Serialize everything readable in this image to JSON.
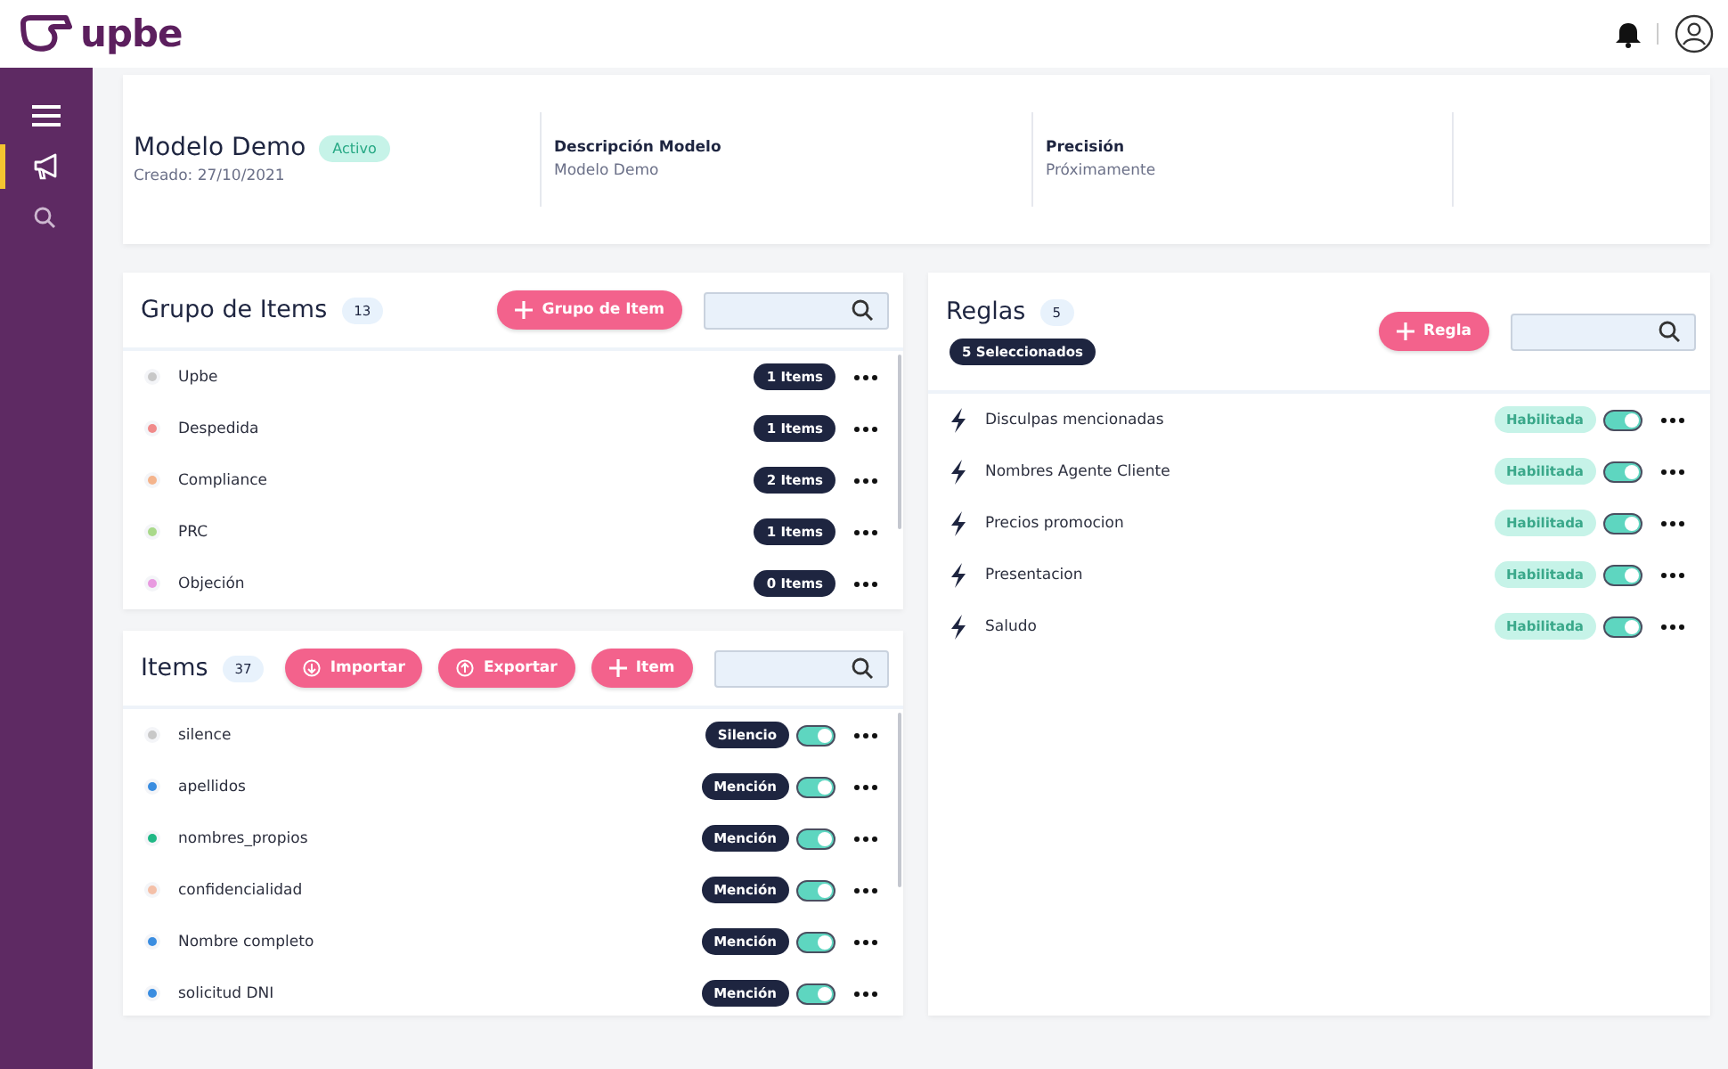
{
  "header": {
    "brand": "upbe"
  },
  "sidebar": {
    "items": [
      {
        "kind": "megaphone",
        "selected": true
      },
      {
        "kind": "search",
        "selected": false
      }
    ]
  },
  "model": {
    "title": "Modelo Demo",
    "status": "Activo",
    "created": "Creado: 27/10/2021",
    "fields": [
      {
        "label": "Descripción Modelo",
        "value": "Modelo Demo"
      },
      {
        "label": "Precisión",
        "value": "Próximamente"
      }
    ]
  },
  "groups": {
    "title": "Grupo de Items",
    "count": "13",
    "buttons": [
      {
        "kind": "plus",
        "label": "Grupo de Item"
      }
    ],
    "rows": [
      {
        "name": "Upbe",
        "color": "#c8c8c8",
        "badge": "1 Items"
      },
      {
        "name": "Despedida",
        "color": "#f08a8a",
        "badge": "1 Items"
      },
      {
        "name": "Compliance",
        "color": "#f4b48c",
        "badge": "2 Items"
      },
      {
        "name": "PRC",
        "color": "#a9d98a",
        "badge": "1 Items"
      },
      {
        "name": "Objeción",
        "color": "#e89ae0",
        "badge": "0 Items"
      }
    ]
  },
  "items": {
    "title": "Items",
    "count": "37",
    "buttons": [
      {
        "kind": "download",
        "label": "Importar"
      },
      {
        "kind": "upload",
        "label": "Exportar"
      },
      {
        "kind": "plus",
        "label": "Item"
      }
    ],
    "rows": [
      {
        "name": "silence",
        "color": "#c8c8c8",
        "badge": "Silencio",
        "on": true
      },
      {
        "name": "apellidos",
        "color": "#3a8de0",
        "badge": "Mención",
        "on": true
      },
      {
        "name": "nombres_propios",
        "color": "#1fb885",
        "badge": "Mención",
        "on": true
      },
      {
        "name": "confidencialidad",
        "color": "#f4c0a8",
        "badge": "Mención",
        "on": true
      },
      {
        "name": "Nombre completo",
        "color": "#3a8de0",
        "badge": "Mención",
        "on": true
      },
      {
        "name": "solicitud DNI",
        "color": "#3a8de0",
        "badge": "Mención",
        "on": true
      }
    ]
  },
  "rules": {
    "title": "Reglas",
    "count": "5",
    "selection": "5 Seleccionados",
    "buttons": [
      {
        "kind": "plus",
        "label": "Regla"
      }
    ],
    "rows": [
      {
        "name": "Disculpas mencionadas",
        "status": "Habilitada",
        "on": true
      },
      {
        "name": "Nombres Agente Cliente",
        "status": "Habilitada",
        "on": true
      },
      {
        "name": "Precios promocion",
        "status": "Habilitada",
        "on": true
      },
      {
        "name": "Presentacion",
        "status": "Habilitada",
        "on": true
      },
      {
        "name": "Saludo",
        "status": "Habilitada",
        "on": true
      }
    ]
  }
}
